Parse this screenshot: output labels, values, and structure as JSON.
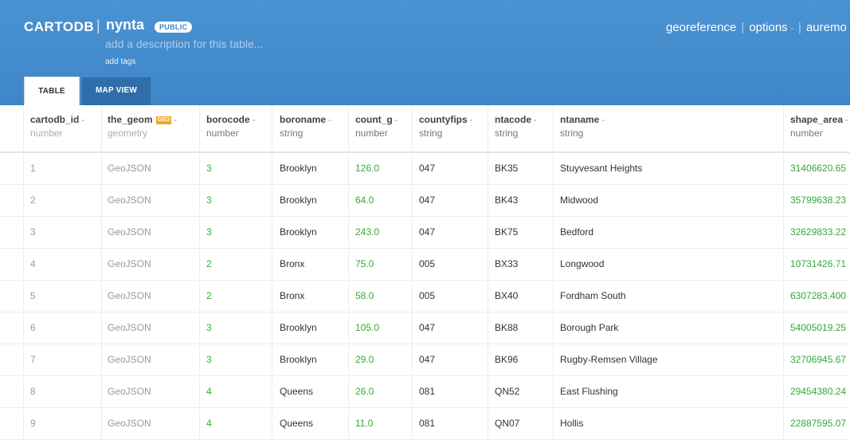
{
  "header": {
    "logo": "CARTODB",
    "separator": "|",
    "table_name": "nynta",
    "privacy": "PUBLIC",
    "description_placeholder": "add a description for this table...",
    "tags_link": "add tags",
    "nav": {
      "georeference": "georeference",
      "options": "options",
      "user": "auremo"
    },
    "tabs": {
      "table": "TABLE",
      "map": "MAP VIEW"
    }
  },
  "columns": [
    {
      "name": "cartodb_id",
      "type": "number"
    },
    {
      "name": "the_geom",
      "type": "geometry",
      "badge": "GEO"
    },
    {
      "name": "borocode",
      "type": "number"
    },
    {
      "name": "boroname",
      "type": "string"
    },
    {
      "name": "count_g",
      "type": "number"
    },
    {
      "name": "countyfips",
      "type": "string"
    },
    {
      "name": "ntacode",
      "type": "string"
    },
    {
      "name": "ntaname",
      "type": "string"
    },
    {
      "name": "shape_area",
      "type": "number"
    }
  ],
  "rows": [
    [
      "1",
      "GeoJSON",
      "3",
      "Brooklyn",
      "126.0",
      "047",
      "BK35",
      "Stuyvesant Heights",
      "31406620.65"
    ],
    [
      "2",
      "GeoJSON",
      "3",
      "Brooklyn",
      "64.0",
      "047",
      "BK43",
      "Midwood",
      "35799638.23"
    ],
    [
      "3",
      "GeoJSON",
      "3",
      "Brooklyn",
      "243.0",
      "047",
      "BK75",
      "Bedford",
      "32629833.22"
    ],
    [
      "4",
      "GeoJSON",
      "2",
      "Bronx",
      "75.0",
      "005",
      "BX33",
      "Longwood",
      "10731426.71"
    ],
    [
      "5",
      "GeoJSON",
      "2",
      "Bronx",
      "58.0",
      "005",
      "BX40",
      "Fordham South",
      "6307283.400"
    ],
    [
      "6",
      "GeoJSON",
      "3",
      "Brooklyn",
      "105.0",
      "047",
      "BK88",
      "Borough Park",
      "54005019.25"
    ],
    [
      "7",
      "GeoJSON",
      "3",
      "Brooklyn",
      "29.0",
      "047",
      "BK96",
      "Rugby-Remsen Village",
      "32706945.67"
    ],
    [
      "8",
      "GeoJSON",
      "4",
      "Queens",
      "26.0",
      "081",
      "QN52",
      "East Flushing",
      "29454380.24"
    ],
    [
      "9",
      "GeoJSON",
      "4",
      "Queens",
      "11.0",
      "081",
      "QN07",
      "Hollis",
      "22887595.07"
    ]
  ],
  "colors": {
    "header_bg": "#4a93d2",
    "number_text": "#3aa63a",
    "geo_badge": "#f1a923"
  }
}
